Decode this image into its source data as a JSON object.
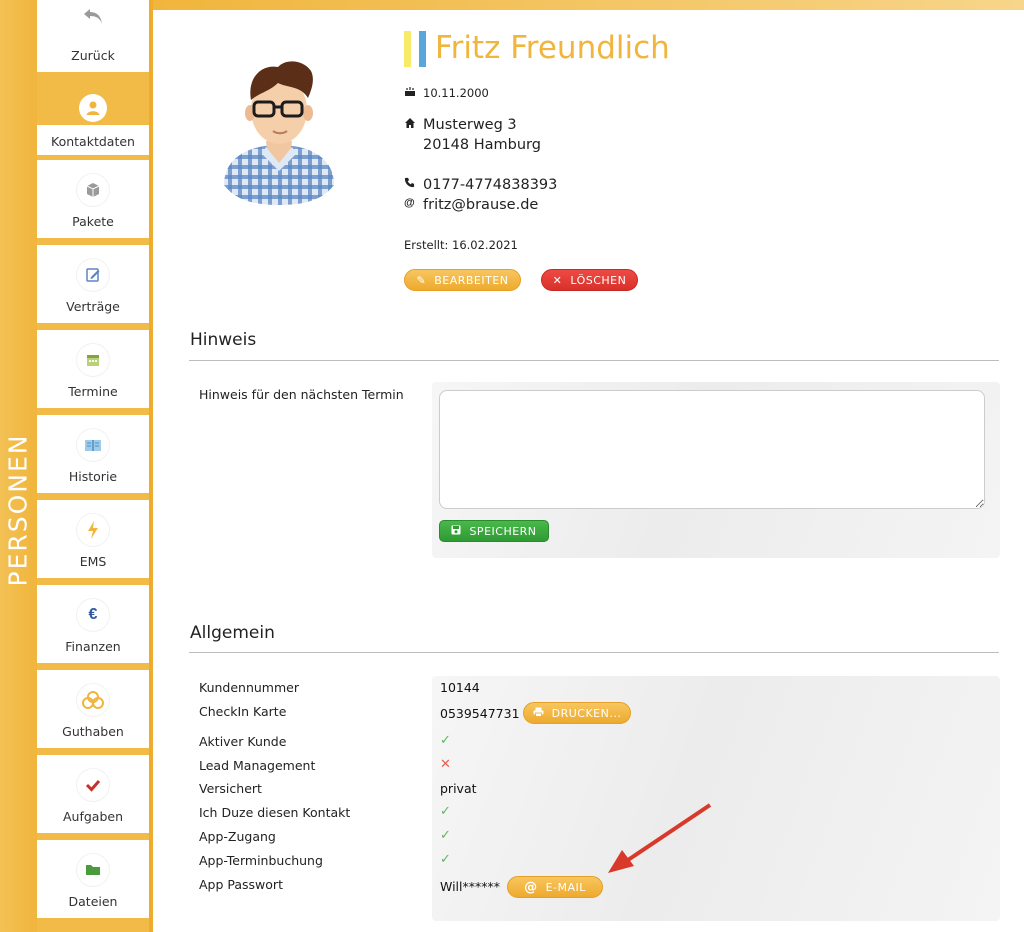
{
  "side_label": "PERSONEN",
  "nav": [
    {
      "label": "Zurück",
      "icon": "back-arrow-icon"
    },
    {
      "label": "Kontaktdaten",
      "icon": "contact-user-icon"
    },
    {
      "label": "Pakete",
      "icon": "packages-icon"
    },
    {
      "label": "Verträge",
      "icon": "contract-edit-icon"
    },
    {
      "label": "Termine",
      "icon": "calendar-icon"
    },
    {
      "label": "Historie",
      "icon": "history-book-icon"
    },
    {
      "label": "EMS",
      "icon": "lightning-icon"
    },
    {
      "label": "Finanzen",
      "icon": "euro-icon"
    },
    {
      "label": "Guthaben",
      "icon": "coins-icon"
    },
    {
      "label": "Aufgaben",
      "icon": "check-task-icon"
    },
    {
      "label": "Dateien",
      "icon": "folder-icon"
    }
  ],
  "contact": {
    "name": "Fritz Freundlich",
    "birthday": "10.11.2000",
    "street": "Musterweg 3",
    "city": "20148 Hamburg",
    "phone": "0177-4774838393",
    "email": "fritz@brause.de",
    "created": "Erstellt: 16.02.2021",
    "edit_label": "BEARBEITEN",
    "delete_label": "LÖSCHEN"
  },
  "hint_section": {
    "title": "Hinweis",
    "label": "Hinweis für den nächsten Termin",
    "value": "",
    "save_label": "SPEICHERN"
  },
  "general": {
    "title": "Allgemein",
    "rows": [
      {
        "label": "Kundennummer",
        "value": "10144"
      },
      {
        "label": "CheckIn Karte",
        "value": "0539547731",
        "button": "DRUCKEN..."
      },
      {
        "label": "Aktiver Kunde",
        "value": "✓"
      },
      {
        "label": "Lead Management",
        "value": "✕"
      },
      {
        "label": "Versichert",
        "value": "privat"
      },
      {
        "label": "Ich Duze diesen Kontakt",
        "value": "✓"
      },
      {
        "label": "App-Zugang",
        "value": "✓"
      },
      {
        "label": "App-Terminbuchung",
        "value": "✓"
      },
      {
        "label": "App Passwort",
        "value": "Will******",
        "button": "E-MAIL"
      }
    ]
  },
  "colors": {
    "accent": "#f0b53c",
    "danger": "#d9302a",
    "success": "#2f9a33",
    "arrow": "#d8392b"
  }
}
